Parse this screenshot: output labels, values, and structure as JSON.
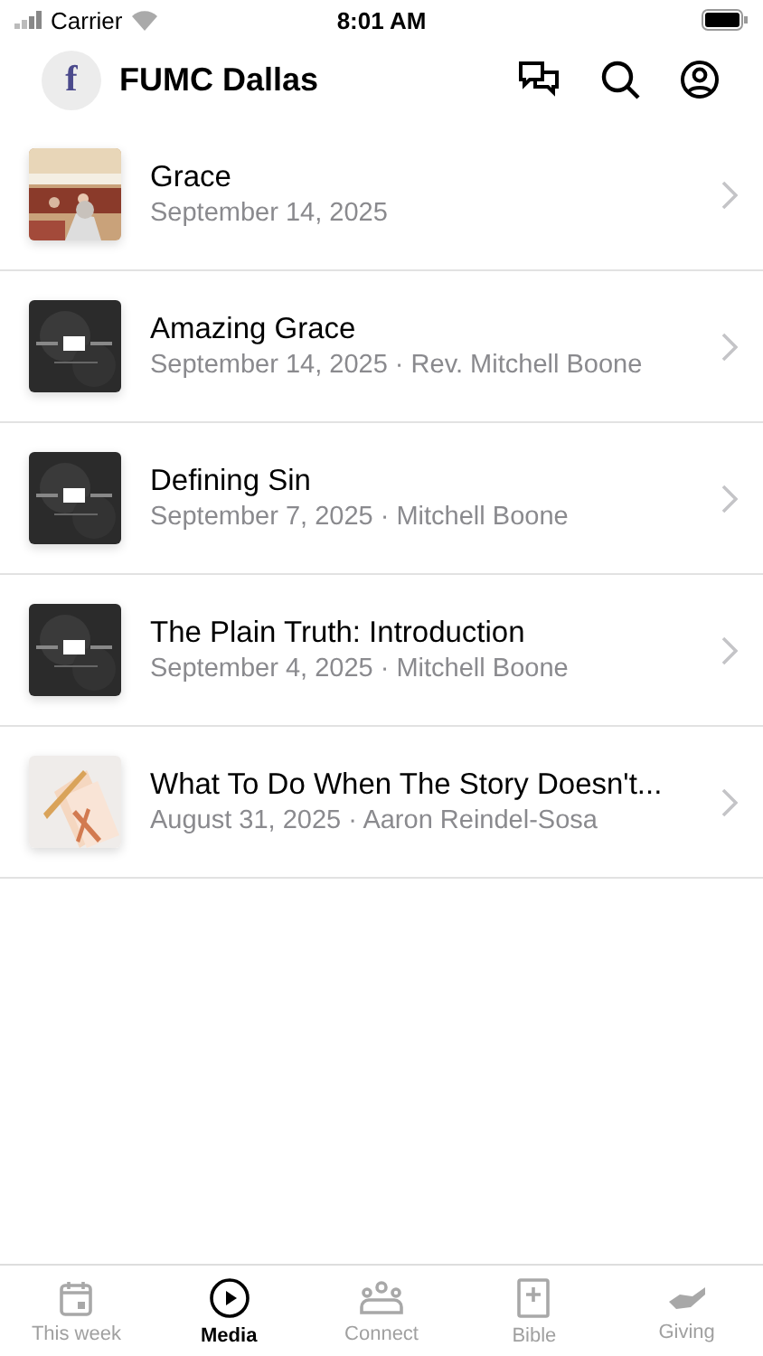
{
  "status_bar": {
    "carrier": "Carrier",
    "time": "8:01 AM"
  },
  "header": {
    "title": "FUMC Dallas",
    "logo_letter": "f"
  },
  "items": [
    {
      "title": "Grace",
      "subtitle": "September 14, 2025"
    },
    {
      "title": "Amazing Grace",
      "subtitle": "September 14, 2025 · Rev. Mitchell Boone"
    },
    {
      "title": "Defining Sin",
      "subtitle": "September 7, 2025 · Mitchell Boone"
    },
    {
      "title": "The Plain Truth: Introduction",
      "subtitle": "September 4, 2025 · Mitchell Boone"
    },
    {
      "title": "What To Do When The Story Doesn't...",
      "subtitle": "August 31, 2025 · Aaron Reindel-Sosa"
    }
  ],
  "tabs": [
    {
      "label": "This week",
      "selected": false
    },
    {
      "label": "Media",
      "selected": true
    },
    {
      "label": "Connect",
      "selected": false
    },
    {
      "label": "Bible",
      "selected": false
    },
    {
      "label": "Giving",
      "selected": false
    }
  ]
}
